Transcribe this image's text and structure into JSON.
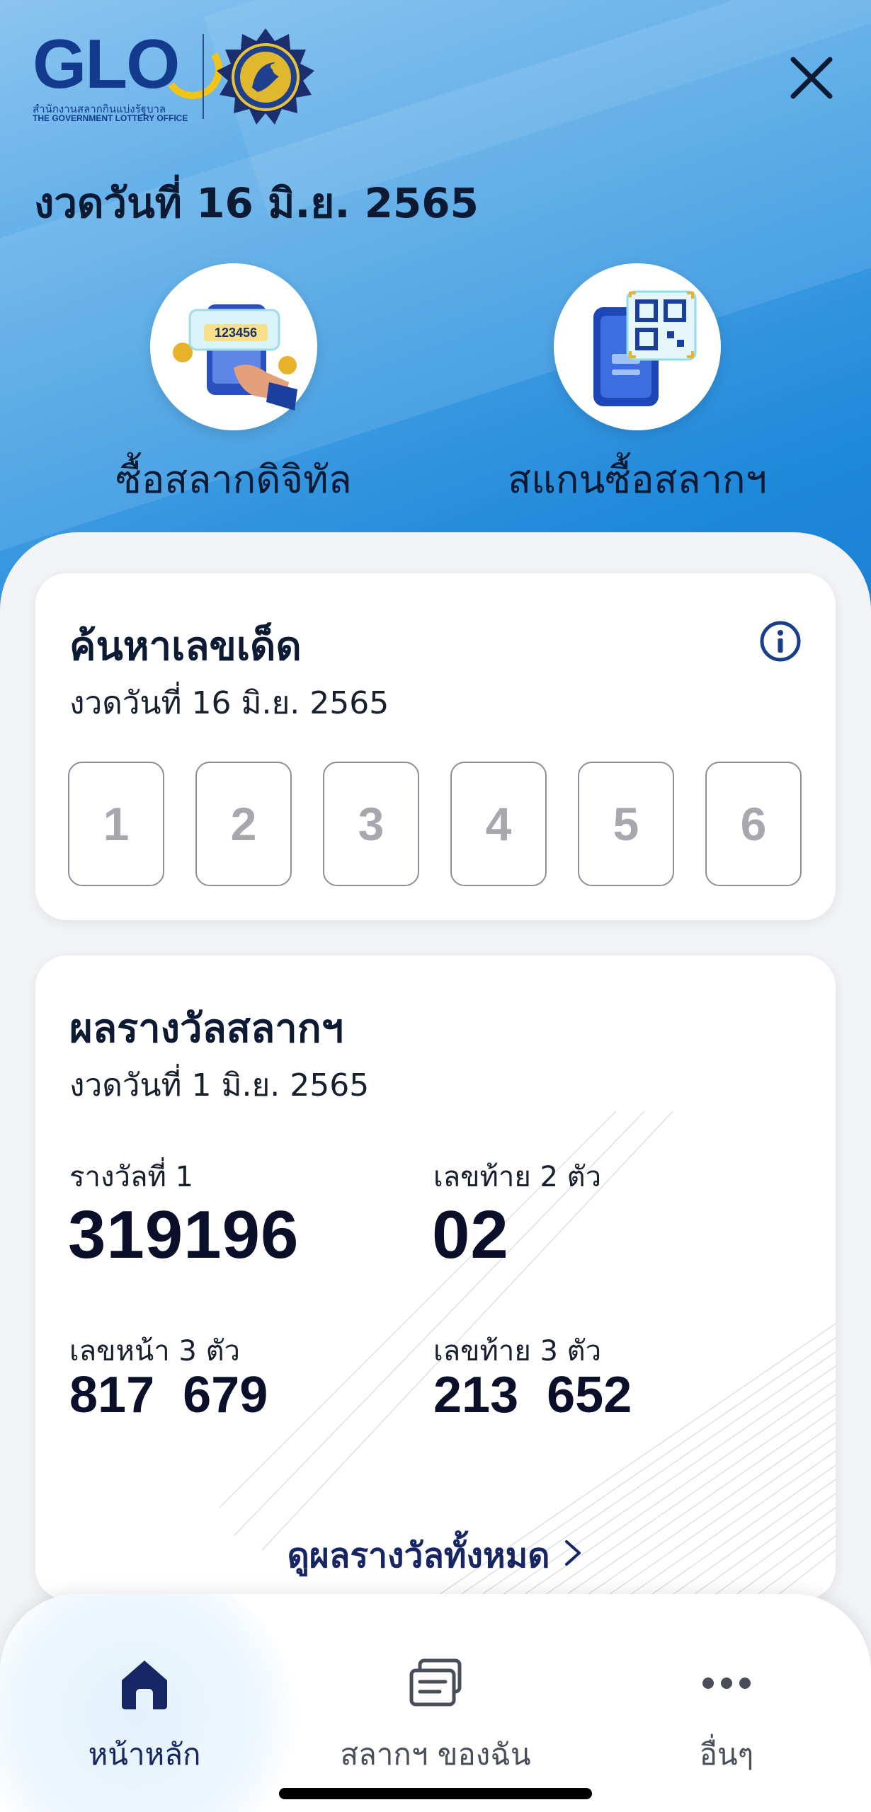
{
  "header": {
    "logo_text": "GLO",
    "logo_sub_th": "สำนักงานสลากกินแบ่งรัฐบาล",
    "logo_sub_en": "THE GOVERNMENT LOTTERY OFFICE",
    "draw_date": "งวดวันที่ 16 มิ.ย. 2565"
  },
  "actions": [
    {
      "label": "ซื้อสลากดิจิทัล",
      "icon": "digital-lottery-phone-icon",
      "ticket_number": "123456"
    },
    {
      "label": "สแกนซื้อสลากฯ",
      "icon": "qr-scan-phone-icon"
    }
  ],
  "search_card": {
    "title": "ค้นหาเลขเด็ด",
    "date": "งวดวันที่  16 มิ.ย. 2565",
    "digits": [
      "1",
      "2",
      "3",
      "4",
      "5",
      "6"
    ]
  },
  "results_card": {
    "title": "ผลรางวัลสลากฯ",
    "date": "งวดวันที่  1 มิ.ย. 2565",
    "first_prize_label": "รางวัลที่ 1",
    "first_prize": "319196",
    "last2_label": "เลขท้าย 2 ตัว",
    "last2": "02",
    "front3_label": "เลขหน้า 3 ตัว",
    "front3": "817  679",
    "last3_label": "เลขท้าย 3 ตัว",
    "last3": "213  652",
    "view_all": "ดูผลรางวัลทั้งหมด"
  },
  "tabbar": {
    "items": [
      {
        "label": "หน้าหลัก",
        "icon": "home-icon",
        "active": true
      },
      {
        "label": "สลากฯ ของฉัน",
        "icon": "my-tickets-icon",
        "active": false
      },
      {
        "label": "อื่นๆ",
        "icon": "more-icon",
        "active": false
      }
    ]
  },
  "colors": {
    "brand_navy": "#123b8e",
    "brand_yellow": "#f2c318",
    "hero_blue": "#1e88da",
    "active_tab": "#162563",
    "inactive_tab": "#4a4e5a"
  }
}
